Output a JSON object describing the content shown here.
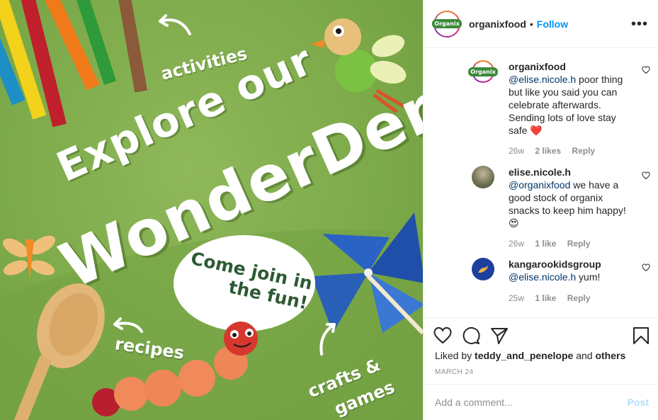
{
  "post": {
    "image": {
      "headline_line1": "Explore our",
      "headline_line2": "WonderDen!",
      "label_activities": "activities",
      "label_recipes": "recipes",
      "label_crafts_line1": "crafts &",
      "label_crafts_line2": "games",
      "bubble_line1": "Come join in",
      "bubble_line2": "the fun!"
    }
  },
  "header": {
    "username": "organixfood",
    "separator": "•",
    "follow_label": "Follow",
    "more_icon": "more-horizontal-icon",
    "logo_text": "Organix"
  },
  "comments": [
    {
      "username": "organixfood",
      "mention": "@elise.nicole.h",
      "text": " poor thing but like you said you can celebrate afterwards. Sending lots of love stay safe ❤️",
      "time": "26w",
      "likes": "2 likes",
      "reply": "Reply"
    },
    {
      "username": "elise.nicole.h",
      "mention": "@organixfood",
      "text": " we have a good stock of organix snacks to keep him happy! 😍",
      "time": "26w",
      "likes": "1 like",
      "reply": "Reply"
    },
    {
      "username": "kangarookidsgroup",
      "mention": "@elise.nicole.h",
      "text": " yum!",
      "time": "25w",
      "likes": "1 like",
      "reply": "Reply"
    }
  ],
  "actions": {
    "like_icon": "heart-icon",
    "comment_icon": "comment-icon",
    "share_icon": "paper-plane-icon",
    "save_icon": "bookmark-icon",
    "liked_prefix": "Liked by ",
    "liked_user": "teddy_and_penelope",
    "liked_mid": " and ",
    "liked_others": "others",
    "date": "MARCH 24"
  },
  "comment_box": {
    "placeholder": "Add a comment...",
    "post_label": "Post"
  },
  "colors": {
    "link_blue": "#0095f6",
    "mention": "#00376b",
    "post_disabled": "#b2dffc",
    "meta_gray": "#8e8e8e",
    "image_green": "#7daa4a"
  }
}
